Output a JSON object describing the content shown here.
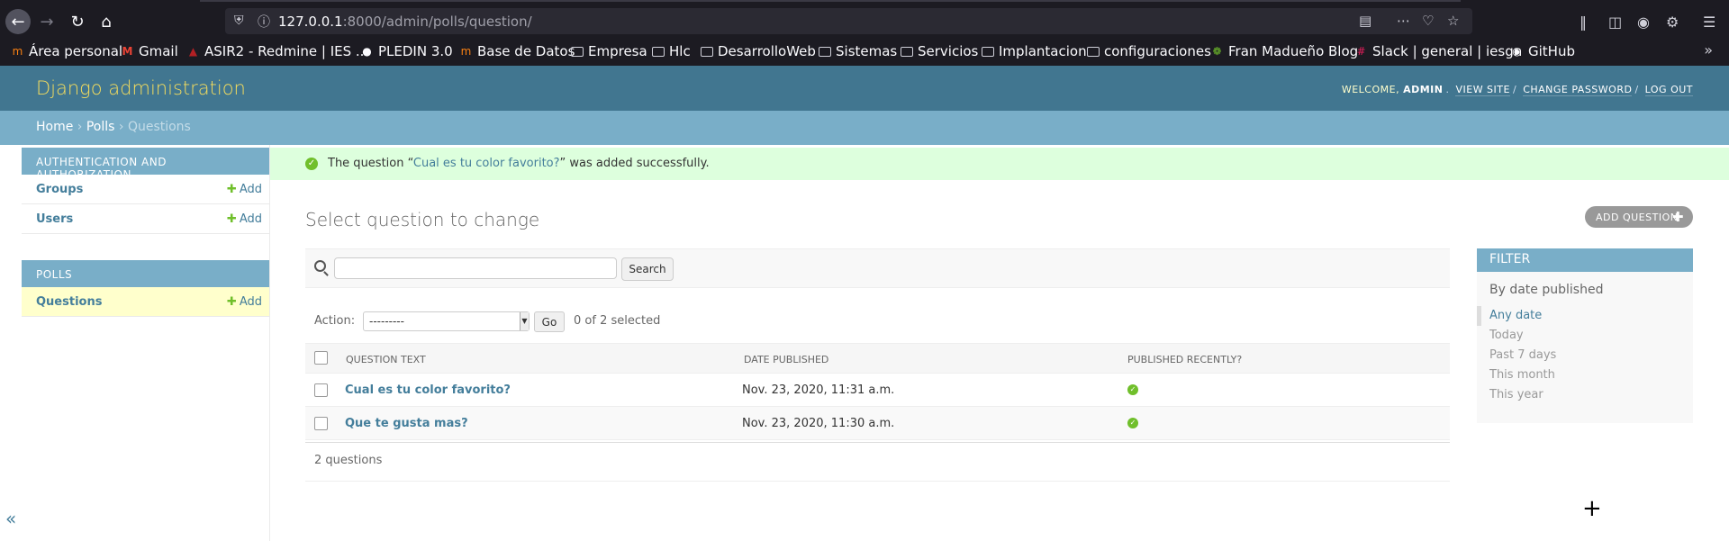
{
  "browser": {
    "url_host": "127.0.0.1",
    "url_rest": ":8000/admin/polls/question/",
    "bookmarks": [
      {
        "label": "Área personal",
        "icon": "moodle-icon"
      },
      {
        "label": "Gmail",
        "icon": "gmail-icon"
      },
      {
        "label": "ASIR2 - Redmine | IES ...",
        "icon": "redmine-icon"
      },
      {
        "label": "PLEDIN 3.0",
        "icon": "globe-icon"
      },
      {
        "label": "Base de Datos",
        "icon": "moodle-icon"
      },
      {
        "label": "Empresa",
        "icon": "folder-icon"
      },
      {
        "label": "Hlc",
        "icon": "folder-icon"
      },
      {
        "label": "DesarrolloWeb",
        "icon": "folder-icon"
      },
      {
        "label": "Sistemas",
        "icon": "folder-icon"
      },
      {
        "label": "Servicios",
        "icon": "folder-icon"
      },
      {
        "label": "Implantacion",
        "icon": "folder-icon"
      },
      {
        "label": "configuraciones",
        "icon": "folder-icon"
      },
      {
        "label": "Fran Madueño Blog",
        "icon": "blog-icon"
      },
      {
        "label": "Slack | general | iesgn",
        "icon": "slack-icon"
      },
      {
        "label": "GitHub",
        "icon": "github-icon"
      }
    ]
  },
  "header": {
    "branding": "Django administration",
    "welcome": "WELCOME,",
    "user": "ADMIN",
    "view_site": "VIEW SITE",
    "change_password": "CHANGE PASSWORD",
    "log_out": "LOG OUT"
  },
  "breadcrumbs": {
    "home": "Home",
    "app": "Polls",
    "current": "Questions"
  },
  "sidebar": {
    "auth_caption": "AUTHENTICATION AND AUTHORIZATION",
    "groups": "Groups",
    "users": "Users",
    "polls_caption": "POLLS",
    "questions": "Questions",
    "add_label": "Add",
    "collapse": "«"
  },
  "message": {
    "prefix": "The question “",
    "link": "Cual es tu color favorito?",
    "suffix": "” was added successfully."
  },
  "content": {
    "title": "Select question to change",
    "add_button": "ADD QUESTION",
    "search_button": "Search",
    "search_value": "",
    "action_label": "Action:",
    "action_selected": "---------",
    "go_button": "Go",
    "selection_counter": "0 of 2 selected",
    "columns": [
      "QUESTION TEXT",
      "DATE PUBLISHED",
      "PUBLISHED RECENTLY?"
    ],
    "rows": [
      {
        "question": "Cual es tu color favorito?",
        "date": "Nov. 23, 2020, 11:31 a.m.",
        "recent": true
      },
      {
        "question": "Que te gusta mas?",
        "date": "Nov. 23, 2020, 11:30 a.m.",
        "recent": true
      }
    ],
    "paginator": "2 questions"
  },
  "filter": {
    "title": "FILTER",
    "subtitle": "By date published",
    "options": [
      "Any date",
      "Today",
      "Past 7 days",
      "This month",
      "This year"
    ],
    "selected": "Any date"
  },
  "colors": {
    "header": "#417690",
    "branding": "#f5dd5d",
    "breadcrumbs": "#79aec8",
    "link": "#447e9b",
    "success": "#70bf2b"
  }
}
